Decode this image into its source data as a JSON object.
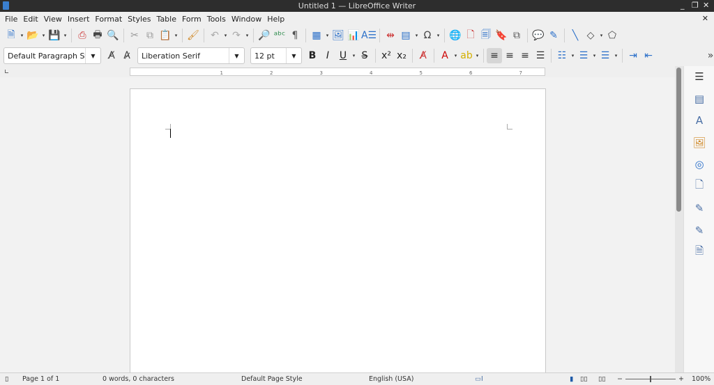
{
  "window": {
    "title": "Untitled 1 — LibreOffice Writer",
    "minimize": "_",
    "maximize": "❐",
    "close": "✕"
  },
  "menu": [
    "File",
    "Edit",
    "View",
    "Insert",
    "Format",
    "Styles",
    "Table",
    "Form",
    "Tools",
    "Window",
    "Help"
  ],
  "menu_close": "✕",
  "toolbar1": [
    [
      "new-document-icon",
      "dd"
    ],
    [
      "open-folder-icon",
      "dd"
    ],
    [
      "save-icon",
      "dd"
    ],
    "sep",
    [
      "export-pdf-icon"
    ],
    [
      "print-icon"
    ],
    [
      "print-preview-icon"
    ],
    "sep",
    [
      "cut-icon"
    ],
    [
      "copy-icon"
    ],
    [
      "paste-icon",
      "dd"
    ],
    "sep",
    [
      "clone-formatting-icon"
    ],
    "sep",
    [
      "undo-icon",
      "dd"
    ],
    [
      "redo-icon",
      "dd"
    ],
    "sep",
    [
      "find-replace-icon"
    ],
    [
      "spelling-icon"
    ],
    [
      "formatting-marks-icon"
    ],
    "sep",
    [
      "insert-table-icon",
      "dd"
    ],
    [
      "insert-image-icon"
    ],
    [
      "insert-chart-icon"
    ],
    [
      "insert-textbox-icon"
    ],
    "sep",
    [
      "page-break-icon"
    ],
    [
      "insert-field-icon",
      "dd"
    ],
    [
      "special-character-icon",
      "dd"
    ],
    "sep",
    [
      "hyperlink-icon"
    ],
    [
      "footnote-icon"
    ],
    [
      "endnote-icon"
    ],
    [
      "bookmark-icon"
    ],
    [
      "cross-reference-icon"
    ],
    "sep",
    [
      "comment-icon"
    ],
    [
      "track-changes-icon"
    ],
    "sep",
    [
      "line-icon"
    ],
    [
      "basic-shapes-icon",
      "dd"
    ],
    [
      "draw-functions-icon"
    ]
  ],
  "paragraph_style": "Default Paragraph Styl",
  "font_name": "Liberation Serif",
  "font_size": "12 pt",
  "toolbar2": [
    [
      "bold-icon"
    ],
    [
      "italic-icon"
    ],
    [
      "underline-icon",
      "dd"
    ],
    [
      "strikethrough-icon"
    ],
    "sep",
    [
      "superscript-icon"
    ],
    [
      "subscript-icon"
    ],
    "sep",
    [
      "clear-formatting-icon"
    ],
    "sep",
    [
      "font-color-icon",
      "dd"
    ],
    [
      "highlight-color-icon",
      "dd"
    ],
    "sep",
    [
      "align-left-icon",
      "active"
    ],
    [
      "align-center-icon"
    ],
    [
      "align-right-icon"
    ],
    [
      "justify-icon"
    ],
    "sep",
    [
      "bullet-list-icon",
      "dd"
    ],
    [
      "numbered-list-icon",
      "dd"
    ],
    [
      "outline-list-icon",
      "dd"
    ],
    "sep",
    [
      "increase-indent-icon"
    ],
    [
      "decrease-indent-icon"
    ]
  ],
  "ruler_labels": [
    "1",
    "2",
    "3",
    "4",
    "5",
    "6",
    "7"
  ],
  "sidebar": [
    "menu-icon",
    "properties-icon",
    "styles-icon",
    "gallery-icon",
    "navigator-icon",
    "page-icon",
    "style-inspector-icon",
    "manage-changes-icon",
    "design-icon"
  ],
  "status": {
    "page": "Page 1 of 1",
    "words": "0 words, 0 characters",
    "page_style": "Default Page Style",
    "language": "English (USA)",
    "zoom": "100%",
    "zoom_value": 100
  }
}
